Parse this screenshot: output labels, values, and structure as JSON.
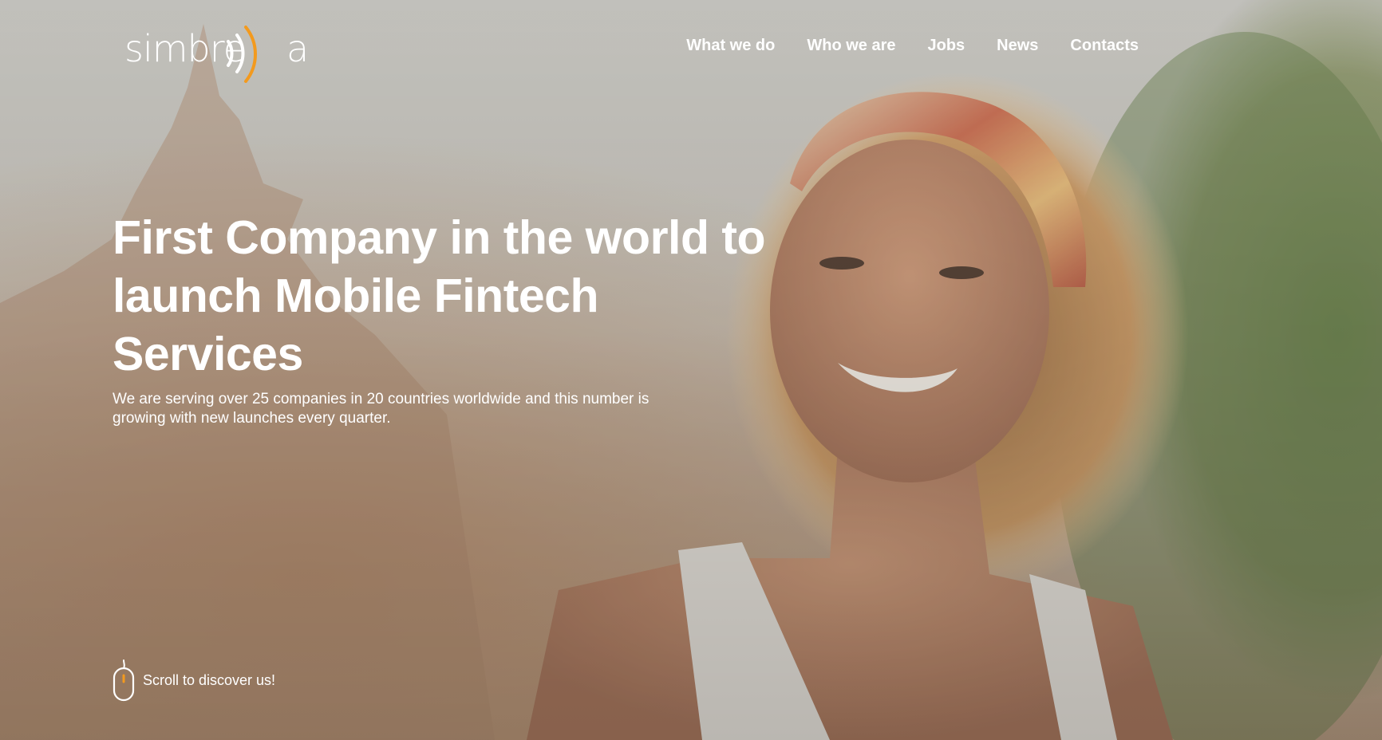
{
  "brand": {
    "logo_text": "simbre",
    "logo_tail": "a",
    "accent_color": "#f39a1e"
  },
  "nav": {
    "items": [
      {
        "label": "What we do"
      },
      {
        "label": "Who we are"
      },
      {
        "label": "Jobs"
      },
      {
        "label": "News"
      },
      {
        "label": "Contacts"
      }
    ]
  },
  "hero": {
    "title": "First Company in the world to launch Mobile Fintech Services",
    "subtitle": "We are serving over 25 companies in 20 countries worldwide and this number is growing with new launches every quarter.",
    "background": "photo-smiling-woman-outdoors"
  },
  "scroll": {
    "label": "Scroll to discover us!",
    "icon": "mouse-icon"
  }
}
